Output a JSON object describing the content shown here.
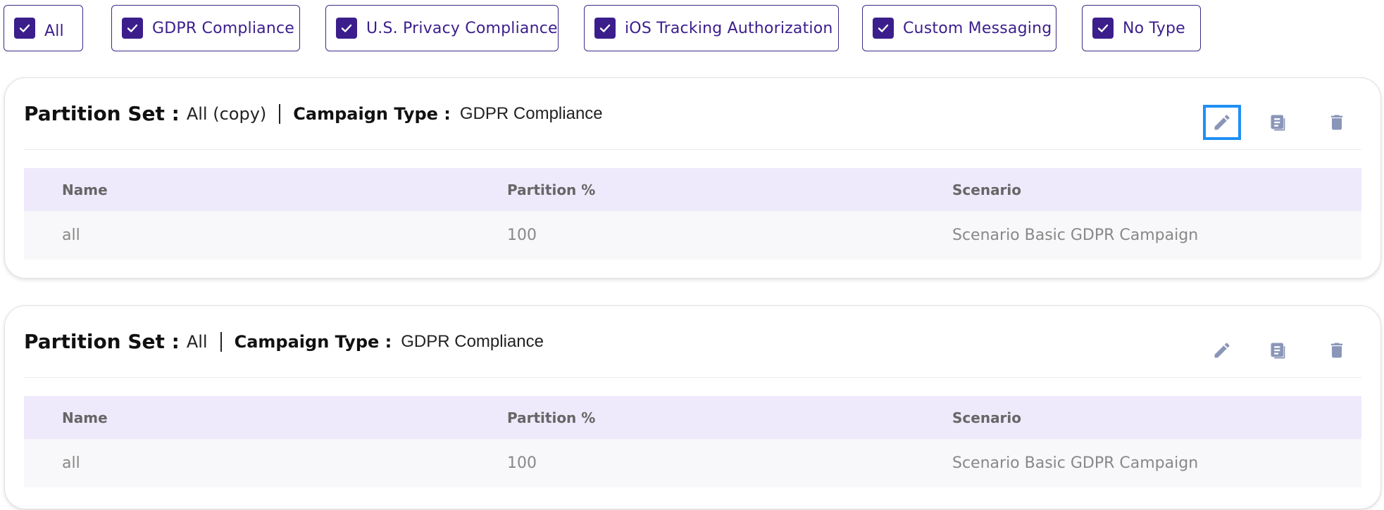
{
  "filters": [
    {
      "label": "All",
      "checked": true
    },
    {
      "label": "GDPR Compliance",
      "checked": true
    },
    {
      "label": "U.S. Privacy Compliance",
      "checked": true
    },
    {
      "label": "iOS Tracking Authorization",
      "checked": true
    },
    {
      "label": "Custom Messaging",
      "checked": true
    },
    {
      "label": "No Type",
      "checked": true
    }
  ],
  "cards": [
    {
      "partition_set_label": "Partition Set :",
      "partition_set_value": "All (copy)",
      "campaign_type_label": "Campaign Type :",
      "campaign_type_value": "GDPR Compliance",
      "columns": [
        "Name",
        "Partition %",
        "Scenario"
      ],
      "rows": [
        {
          "name": "all",
          "partition": "100",
          "scenario": "Scenario Basic GDPR Campaign"
        }
      ]
    },
    {
      "partition_set_label": "Partition Set :",
      "partition_set_value": "All",
      "campaign_type_label": "Campaign Type :",
      "campaign_type_value": "GDPR Compliance",
      "columns": [
        "Name",
        "Partition %",
        "Scenario"
      ],
      "rows": [
        {
          "name": "all",
          "partition": "100",
          "scenario": "Scenario Basic GDPR Campaign"
        }
      ]
    }
  ],
  "icons": {
    "edit": "pencil-icon",
    "copy": "document-copy-icon",
    "delete": "trash-icon",
    "check": "checkmark-icon"
  },
  "colors": {
    "accent": "#3b1e8c",
    "focus": "#1f8ff5",
    "icon": "#8a96b8",
    "table_header_bg": "#efe9fc",
    "table_row_bg": "#f8f8fa"
  }
}
